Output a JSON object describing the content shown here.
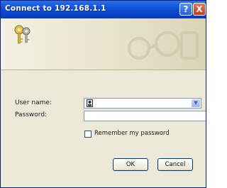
{
  "window": {
    "title": "Connect to 192.168.1.1",
    "help_label": "?",
    "close_label": "X"
  },
  "banner": {
    "icon": "keys-icon"
  },
  "form": {
    "user_name_label": "User name:",
    "user_name_value": "",
    "password_label": "Password:",
    "password_value": "",
    "remember_label": "Remember my password",
    "remember_checked": false
  },
  "buttons": {
    "ok_label": "OK",
    "cancel_label": "Cancel"
  },
  "colors": {
    "titlebar": "#0c4fd8",
    "dialog_bg": "#ece9d8",
    "field_border": "#7f9db9",
    "close_button": "#c83b16"
  }
}
